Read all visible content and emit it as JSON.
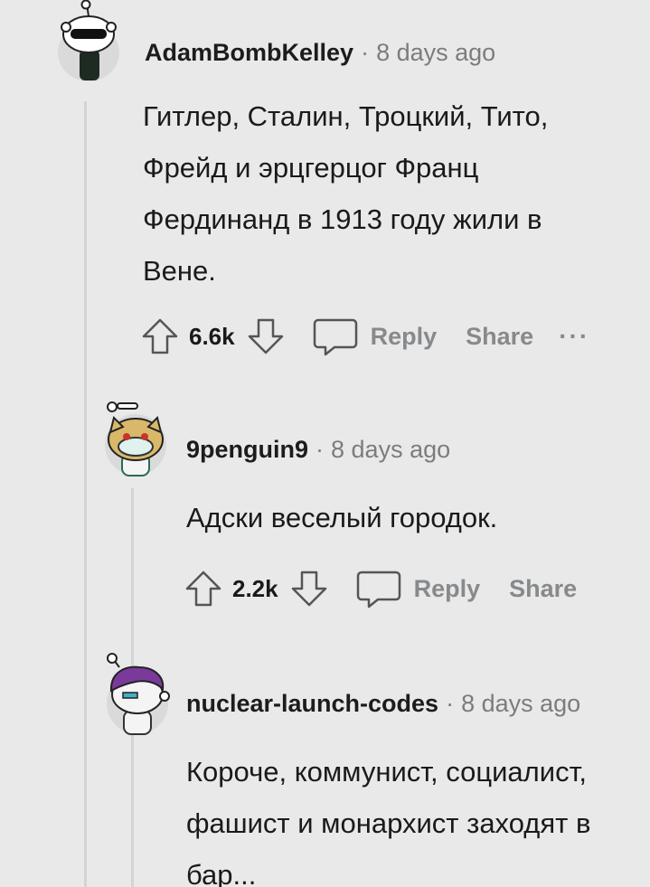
{
  "colors": {
    "background": "#e9e9e9",
    "thread_line": "#d4d4d4",
    "muted": "#878a8c",
    "text": "#1a1a1b"
  },
  "comments": [
    {
      "username": "AdamBombKelley",
      "separator": "·",
      "time": "8 days ago",
      "avatar_icon": "avatar-sunglasses-icon",
      "body": "Гитлер, Сталин, Троцкий, Тито, Фрейд и эрцгерцог Франц Фердинанд в 1913 году жили в Вене.",
      "score": "6.6k",
      "reply_label": "Reply",
      "share_label": "Share",
      "more_label": "···"
    },
    {
      "username": "9penguin9",
      "separator": "·",
      "time": "8 days ago",
      "avatar_icon": "avatar-dog-mask-icon",
      "body": "Адски веселый городок.",
      "score": "2.2k",
      "reply_label": "Reply",
      "share_label": "Share"
    },
    {
      "username": "nuclear-launch-codes",
      "separator": "·",
      "time": "8 days ago",
      "avatar_icon": "avatar-purple-hair-icon",
      "body": "Короче, коммунист, социалист, фашист и монархист заходят в бар..."
    }
  ]
}
